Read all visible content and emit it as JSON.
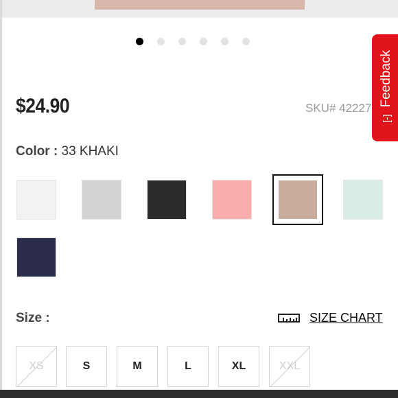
{
  "price": "$24.90",
  "sku": "SKU# 42227",
  "feedback": {
    "label": "Feedback",
    "icon": "[-]"
  },
  "carousel": {
    "total": 6,
    "active": 0
  },
  "color": {
    "label": "Color :",
    "selected_value": "33 KHAKI",
    "swatches": [
      {
        "name": "white",
        "hex": "#f2f2f2"
      },
      {
        "name": "light-gray",
        "hex": "#d4d1d1"
      },
      {
        "name": "black",
        "hex": "#2b2b2b"
      },
      {
        "name": "pink",
        "hex": "#f9aeac"
      },
      {
        "name": "khaki",
        "hex": "#c8ab9b",
        "selected": true
      },
      {
        "name": "mint",
        "hex": "#d9ece8"
      },
      {
        "name": "navy",
        "hex": "#2b2c4a"
      }
    ]
  },
  "size": {
    "label": "Size :",
    "chart_label": "SIZE CHART",
    "options": [
      {
        "label": "XS",
        "available": false
      },
      {
        "label": "S",
        "available": true
      },
      {
        "label": "M",
        "available": true
      },
      {
        "label": "L",
        "available": true
      },
      {
        "label": "XL",
        "available": true
      },
      {
        "label": "XXL",
        "available": false
      }
    ]
  }
}
